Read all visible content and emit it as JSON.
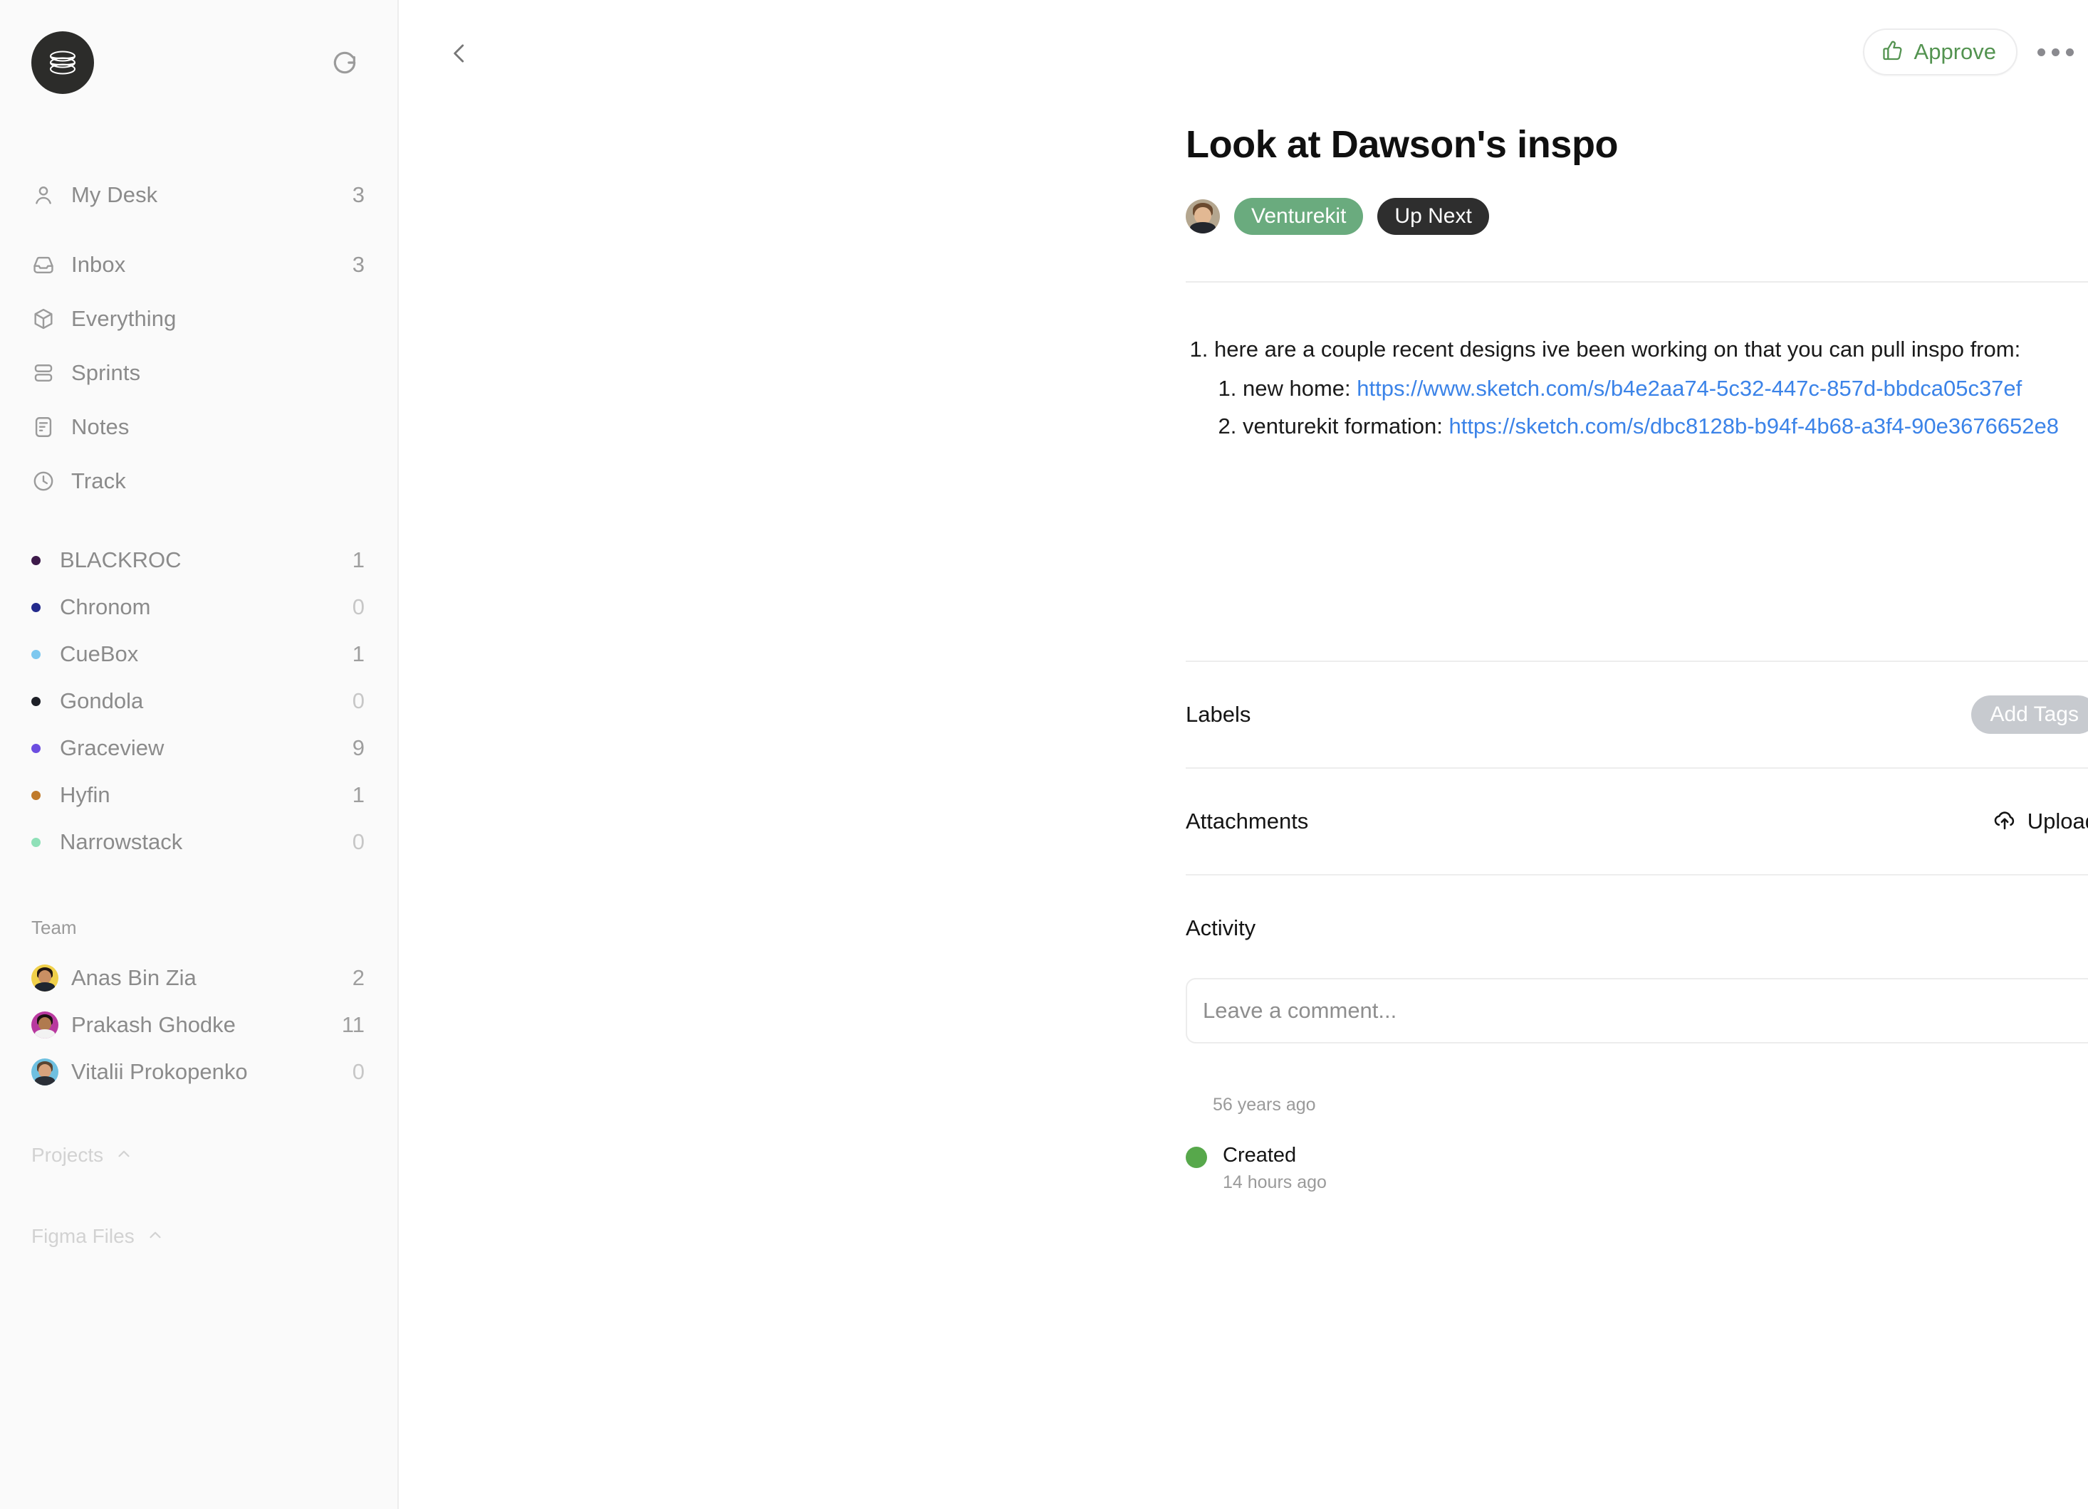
{
  "sidebar": {
    "logo_icon": "coil-logo-icon",
    "refresh_icon": "refresh-icon",
    "nav": [
      {
        "label": "My Desk",
        "count": "3",
        "icon": "person-icon"
      },
      {
        "label": "Inbox",
        "count": "3",
        "icon": "inbox-icon"
      },
      {
        "label": "Everything",
        "count": "",
        "icon": "cube-icon"
      },
      {
        "label": "Sprints",
        "count": "",
        "icon": "sprints-icon"
      },
      {
        "label": "Notes",
        "count": "",
        "icon": "note-icon"
      },
      {
        "label": "Track",
        "count": "",
        "icon": "clock-icon"
      }
    ],
    "projects": [
      {
        "name": "BLACKROC",
        "count": "1",
        "color": "#3d1a4a"
      },
      {
        "name": "Chronom",
        "count": "0",
        "color": "#232a8c"
      },
      {
        "name": "CueBox",
        "count": "1",
        "color": "#7dc8ef"
      },
      {
        "name": "Gondola",
        "count": "0",
        "color": "#1d1f27"
      },
      {
        "name": "Graceview",
        "count": "9",
        "color": "#6c4de0"
      },
      {
        "name": "Hyfin",
        "count": "1",
        "color": "#c07a2a"
      },
      {
        "name": "Narrowstack",
        "count": "0",
        "color": "#8fe0b8"
      }
    ],
    "team_heading": "Team",
    "team": [
      {
        "name": "Anas Bin Zia",
        "count": "2",
        "avatar_bg": "#f0d04a",
        "skin": "#c98f63",
        "hair": "#211611",
        "shirt": "#1e2430"
      },
      {
        "name": "Prakash Ghodke",
        "count": "11",
        "avatar_bg": "#b8399f",
        "skin": "#b07a4f",
        "hair": "#1a1210",
        "shirt": "#f2f2f2"
      },
      {
        "name": "Vitalii Prokopenko",
        "count": "0",
        "avatar_bg": "#6fc0e0",
        "skin": "#d8a27c",
        "hair": "#5a4432",
        "shirt": "#2a2e36"
      }
    ],
    "collapsed_sections": [
      {
        "label": "Projects",
        "icon": "chevron-up-icon"
      },
      {
        "label": "Figma Files",
        "icon": "chevron-up-icon"
      }
    ]
  },
  "header": {
    "back_icon": "chevron-left-icon",
    "approve_label": "Approve",
    "approve_icon": "thumbs-up-icon",
    "approve_color": "#539350",
    "more_icon": "more-horizontal-icon"
  },
  "task": {
    "title": "Look at Dawson's inspo",
    "assignee_avatar": "assignee-avatar",
    "project_tag": "Venturekit",
    "project_tag_color": "#6aab7e",
    "status_tag": "Up Next",
    "status_tag_color": "#2e2e2e",
    "description": {
      "item1": "here are a couple recent designs ive been working on that you can pull inspo from:",
      "sub1_prefix": "new home: ",
      "sub1_link": "https://www.sketch.com/s/b4e2aa74-5c32-447c-857d-bbdca05c37ef",
      "sub2_prefix": "venturekit formation: ",
      "sub2_link": "https://sketch.com/s/dbc8128b-b94f-4b68-a3f4-90e3676652e8"
    }
  },
  "sections": {
    "labels_title": "Labels",
    "add_tags_label": "Add Tags",
    "attachments_title": "Attachments",
    "upload_label": "Upload",
    "upload_icon": "cloud-upload-icon",
    "activity_title": "Activity",
    "comment_placeholder": "Leave a comment...",
    "relative_time": "56 years ago",
    "events": [
      {
        "title": "Created",
        "time": "14 hours ago",
        "dot_color": "#57a84b"
      }
    ]
  }
}
